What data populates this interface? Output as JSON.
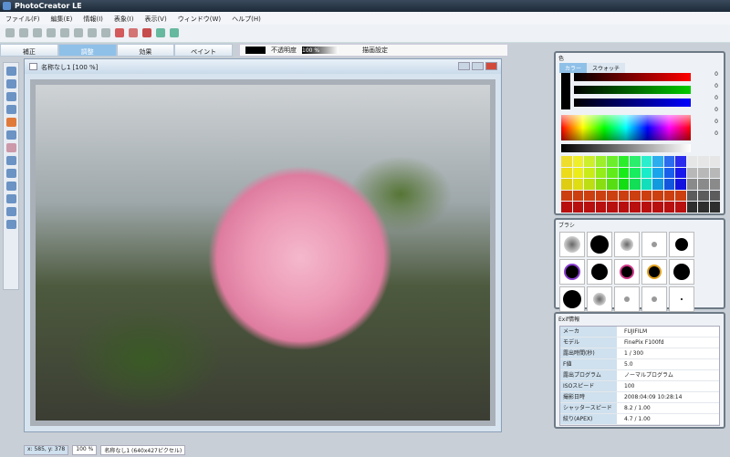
{
  "app": {
    "title": "PhotoCreator LE"
  },
  "menu": [
    "ファイル(F)",
    "編集(E)",
    "情報(I)",
    "表象(I)",
    "表示(V)",
    "ウィンドウ(W)",
    "ヘルプ(H)"
  ],
  "tabs": [
    "補正",
    "調整",
    "効果",
    "ペイント"
  ],
  "options": {
    "opacity_label": "不透明度",
    "opacity_value": "100 %",
    "blend_label": "描画設定"
  },
  "document": {
    "title": "名称なし1 [100 %]"
  },
  "status": {
    "coords": "x: 585, y: 378",
    "zoom": "100 %",
    "size": "名称なし1 (640x427ピクセル)"
  },
  "color_panel": {
    "title": "色",
    "tabs": [
      "カラー",
      "スウォッチ"
    ],
    "values": [
      "0",
      "0",
      "0",
      "0",
      "0",
      "0"
    ]
  },
  "brush_panel": {
    "title": "ブラシ"
  },
  "exif_panel": {
    "title": "Exif情報",
    "rows": [
      {
        "key": "メーカ",
        "value": "FUJIFILM"
      },
      {
        "key": "モデル",
        "value": "FinePix F100fd"
      },
      {
        "key": "露出時間(秒)",
        "value": "1 / 300"
      },
      {
        "key": "F値",
        "value": "5.0"
      },
      {
        "key": "露出プログラム",
        "value": "ノーマルプログラム"
      },
      {
        "key": "ISOスピード",
        "value": "100"
      },
      {
        "key": "撮影日時",
        "value": "2008:04:09 10:28:14"
      },
      {
        "key": "シャッタースピード",
        "value": "8.2 / 1.00"
      },
      {
        "key": "絞り(APEX)",
        "value": "4.7 / 1.00"
      }
    ]
  }
}
